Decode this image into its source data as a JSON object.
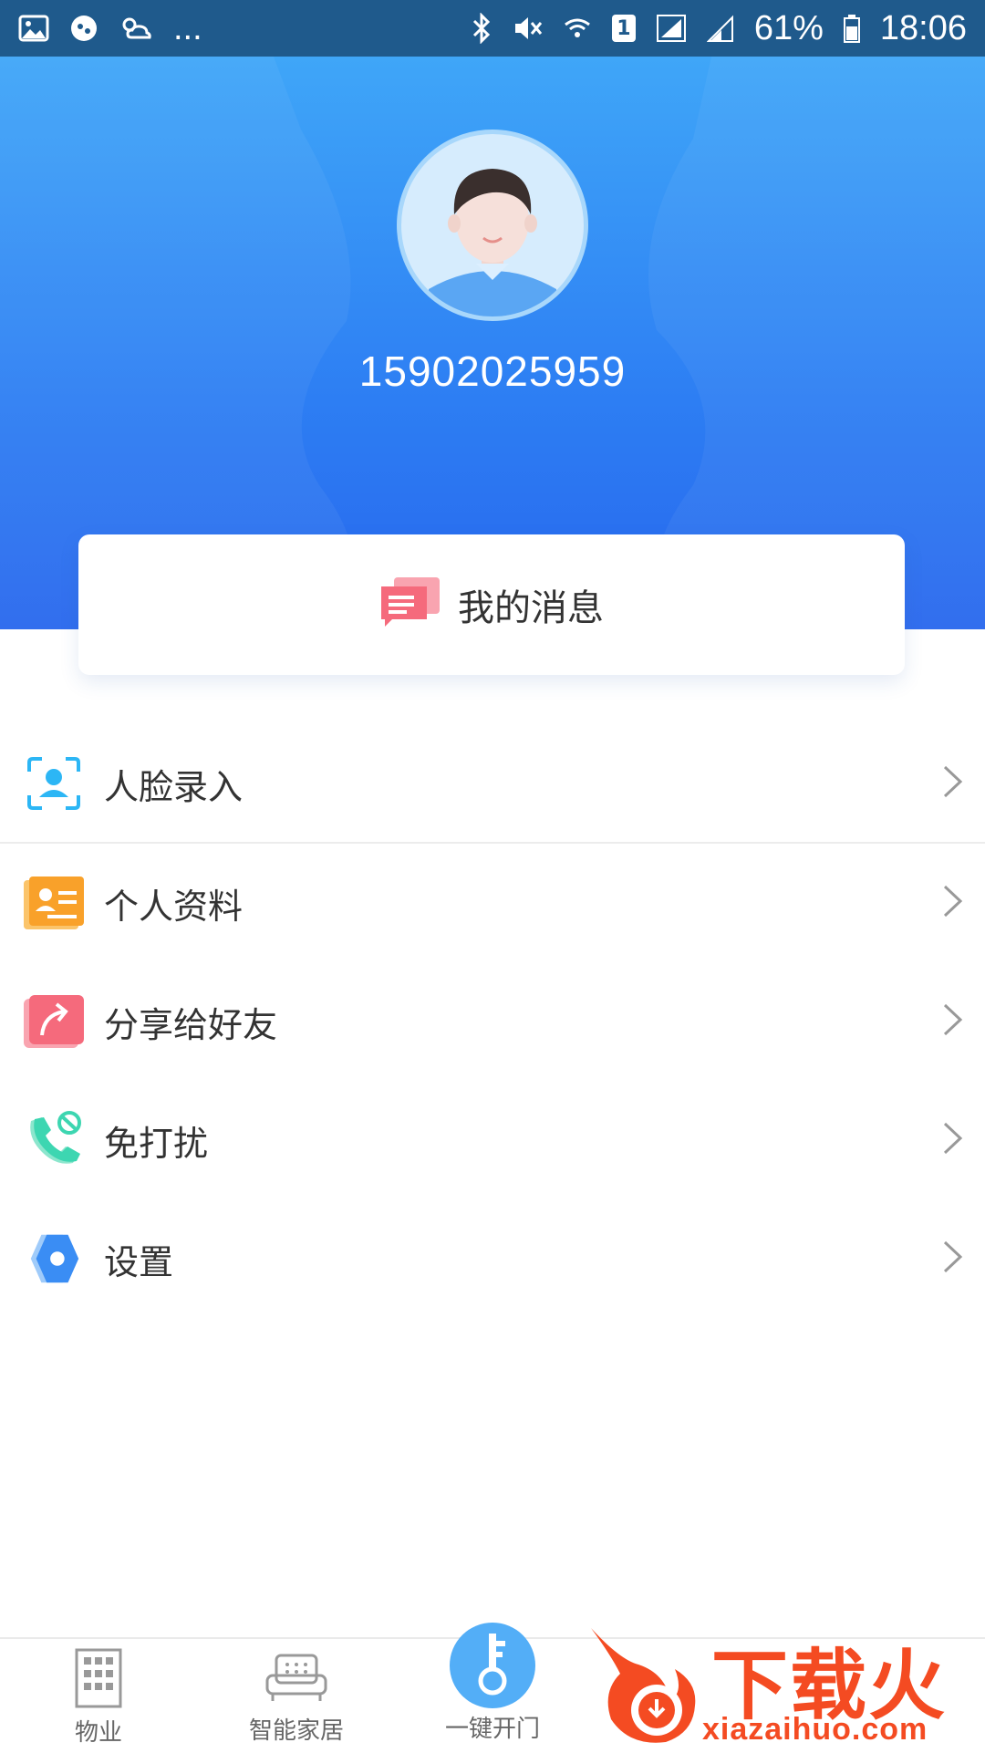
{
  "status_bar": {
    "battery": "61%",
    "time": "18:06",
    "sim": "1",
    "dots": "..."
  },
  "profile": {
    "phone": "15902025959"
  },
  "messages": {
    "label": "我的消息"
  },
  "menu": [
    {
      "label": "人脸录入",
      "icon": "face-scan-icon",
      "color": "#2cb6f5"
    },
    {
      "label": "个人资料",
      "icon": "profile-card-icon",
      "color": "#f9a12a"
    },
    {
      "label": "分享给好友",
      "icon": "share-icon",
      "color": "#f56a7c"
    },
    {
      "label": "免打扰",
      "icon": "do-not-disturb-phone-icon",
      "color": "#3dd6b1"
    },
    {
      "label": "设置",
      "icon": "gear-icon",
      "color": "#3a8df4"
    }
  ],
  "bottom_nav": {
    "property": "物业",
    "smart_home": "智能家居",
    "open_door": "一键开门"
  },
  "watermark": {
    "brand": "下载火",
    "url": "xiazaihuo.com"
  },
  "colors": {
    "header_top": "#3fa6f8",
    "header_bottom": "#2867ee",
    "status_bar": "#1f5a8c",
    "watermark": "#f44b22"
  }
}
